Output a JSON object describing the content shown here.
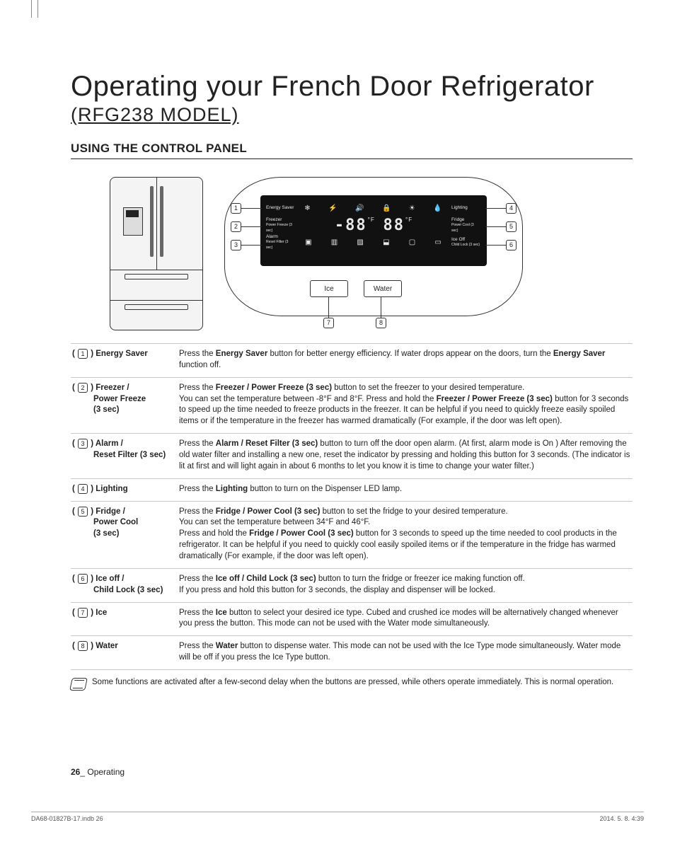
{
  "title": "Operating your French Door Refrigerator",
  "model": "(RFG238 MODEL)",
  "section_heading": "USING THE CONTROL PANEL",
  "panel": {
    "row1_left": "Energy Saver",
    "row1_right": "Lighting",
    "row2_left_line1": "Freezer",
    "row2_left_line2": "Power Freeze (3 sec)",
    "row2_right_line1": "Fridge",
    "row2_right_line2": "Power Cool (3 sec)",
    "seg_left": "-88",
    "seg_right": "88",
    "degF": "°F",
    "row3_left_line1": "Alarm",
    "row3_left_line2": "Reset Filter (3 sec)",
    "row3_right_line1": "Ice Off",
    "row3_right_line2": "Child Lock (3 sec)",
    "icon_labels": [
      "Filter",
      "Cubed",
      "Crushed",
      "Water",
      "Ice Off",
      "Ice Off"
    ],
    "btn_ice": "Ice",
    "btn_water": "Water",
    "callouts": {
      "c1": "1",
      "c2": "2",
      "c3": "3",
      "c4": "4",
      "c5": "5",
      "c6": "6",
      "c7": "7",
      "c8": "8"
    }
  },
  "rows": [
    {
      "num": "1",
      "label": "Energy Saver",
      "sublabels": [],
      "desc": "Press the <b>Energy Saver</b> button for better energy efficiency. If water drops appear on the doors, turn the <b>Energy Saver</b> function off."
    },
    {
      "num": "2",
      "label": "Freezer /",
      "sublabels": [
        "Power Freeze",
        "(3 sec)"
      ],
      "desc": "Press the <b>Freezer / Power Freeze (3 sec)</b> button to set the freezer to your desired temperature.<br>You can set the temperature between -8°F and 8°F. Press and hold the <b>Freezer / Power Freeze (3 sec)</b> button for 3 seconds to speed up the time needed to freeze products in the freezer. It can be helpful if you need to quickly freeze easily spoiled items or if the temperature in the freezer has warmed dramatically (For example, if the door was left open)."
    },
    {
      "num": "3",
      "label": "Alarm /",
      "sublabels": [
        "Reset Filter (3 sec)"
      ],
      "desc": "Press the <b>Alarm / Reset Filter (3 sec)</b> button to turn off the door open alarm. (At first, alarm mode is On ) After removing the old water filter and installing a new one, reset the indicator by pressing and holding this button for 3 seconds. (The indicator is lit at first and will light again in about 6 months to let you know it is time to change your water filter.)"
    },
    {
      "num": "4",
      "label": "Lighting",
      "sublabels": [],
      "desc": "Press the <b>Lighting</b> button to turn on the Dispenser LED lamp."
    },
    {
      "num": "5",
      "label": "Fridge /",
      "sublabels": [
        "Power Cool",
        "(3 sec)"
      ],
      "desc": "Press the <b>Fridge / Power Cool (3 sec)</b> button to set the fridge to your desired temperature.<br>You can set the temperature between 34°F and 46°F.<br>Press and hold the <b>Fridge / Power Cool (3 sec)</b> button for 3 seconds to speed up the time needed to cool products in the refrigerator. It can be helpful if you need to quickly cool easily spoiled items or if the temperature in the fridge has warmed dramatically (For example, if the door was left open)."
    },
    {
      "num": "6",
      "label": "Ice off /",
      "sublabels": [
        "Child Lock (3 sec)"
      ],
      "desc": "Press the <b>Ice off / Child Lock (3 sec)</b> button to turn the fridge or freezer ice making function off.<br>If you press and hold this button for 3 seconds, the display and dispenser will be locked."
    },
    {
      "num": "7",
      "label": "Ice",
      "sublabels": [],
      "desc": "Press the <b>Ice</b> button to select your desired ice type. Cubed and crushed ice modes will be alternatively changed whenever you press the button. This mode can not be used with the Water mode simultaneously."
    },
    {
      "num": "8",
      "label": "Water",
      "sublabels": [],
      "desc": "Press the <b>Water</b> button to dispense water. This mode can not be used with the Ice Type mode simultaneously. Water mode will be off if you press the Ice Type button."
    }
  ],
  "note": "Some functions are activated after a few-second delay when the buttons are pressed, while others operate immediately. This is normal operation.",
  "footer": {
    "page_num": "26",
    "page_section": "_ Operating"
  },
  "printline": {
    "left": "DA68-01827B-17.indb   26",
    "right": "2014. 5. 8.    4:39"
  }
}
